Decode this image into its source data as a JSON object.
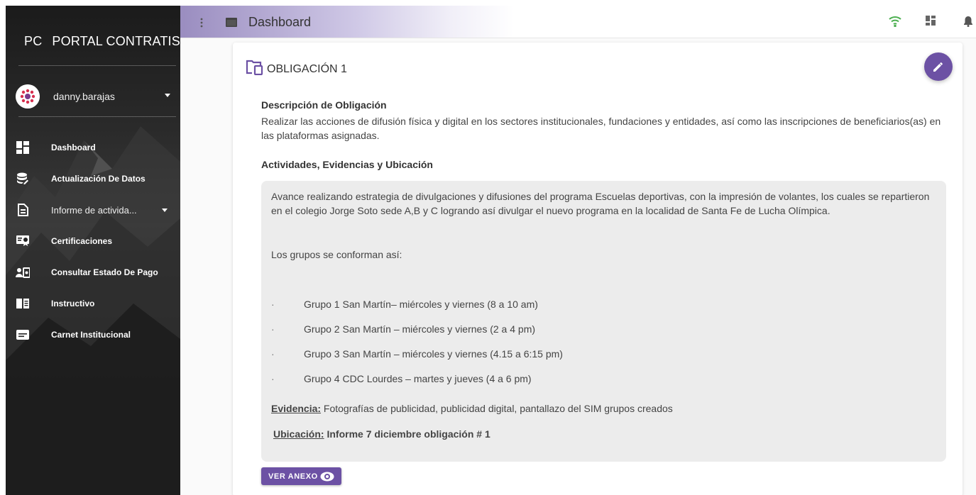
{
  "app": {
    "brand_mini": "PC",
    "brand_title": "PORTAL CONTRATISTA"
  },
  "user": {
    "name": "danny.barajas"
  },
  "sidebar": {
    "items": [
      {
        "label": "Dashboard",
        "icon": "dashboard-icon"
      },
      {
        "label": "Actualización De Datos",
        "icon": "database-edit-icon"
      },
      {
        "label": "Informe de activida...",
        "icon": "document-icon"
      },
      {
        "label": "Certificaciones",
        "icon": "certificate-icon"
      },
      {
        "label": "Consultar Estado De Pago",
        "icon": "payment-status-icon"
      },
      {
        "label": "Instructivo",
        "icon": "book-icon"
      },
      {
        "label": "Carnet Institucional",
        "icon": "id-card-icon"
      }
    ]
  },
  "topbar": {
    "title": "Dashboard",
    "icons": [
      "menu-dots-icon",
      "window-icon",
      "wifi-icon",
      "grid-icon",
      "bell-icon"
    ]
  },
  "card": {
    "title": "OBLIGACIÓN 1",
    "desc_title": "Descripción de Obligación",
    "desc_text": "Realizar las acciones de difusión física y digital en los sectores institucionales, fundaciones y entidades, así como las inscripciones de beneficiarios(as) en las plataformas asignadas.",
    "activities_title": "Actividades, Evidencias y Ubicación",
    "activities_para1": "Avance realizando estrategia de divulgaciones y difusiones del programa Escuelas deportivas, con la impresión de volantes, los cuales se repartieron en el colegio Jorge Soto sede A,B y C logrando así divulgar el nuevo programa en la localidad de Santa Fe de Lucha Olímpica.",
    "activities_para2": "Los grupos se conforman así:",
    "bullet": "·",
    "groups": [
      "Grupo 1 San Martín– miércoles y viernes (8 a 10 am)",
      "Grupo 2 San Martín – miércoles y viernes (2 a 4 pm)",
      "Grupo 3 San Martín – miércoles y viernes (4.15 a 6:15 pm)",
      "Grupo 4 CDC Lourdes – martes y jueves (4 a 6 pm)"
    ],
    "evidence_label": "Evidencia:",
    "evidence_text": " Fotografías de publicidad, publicidad digital, pantallazo del SIM grupos creados",
    "location_label": "Ubicación:",
    "location_text": " Informe 7 diciembre obligación # 1",
    "annex_button": "VER ANEXO"
  },
  "colors": {
    "accent": "#6c51a4",
    "wifi": "#4caf50"
  }
}
